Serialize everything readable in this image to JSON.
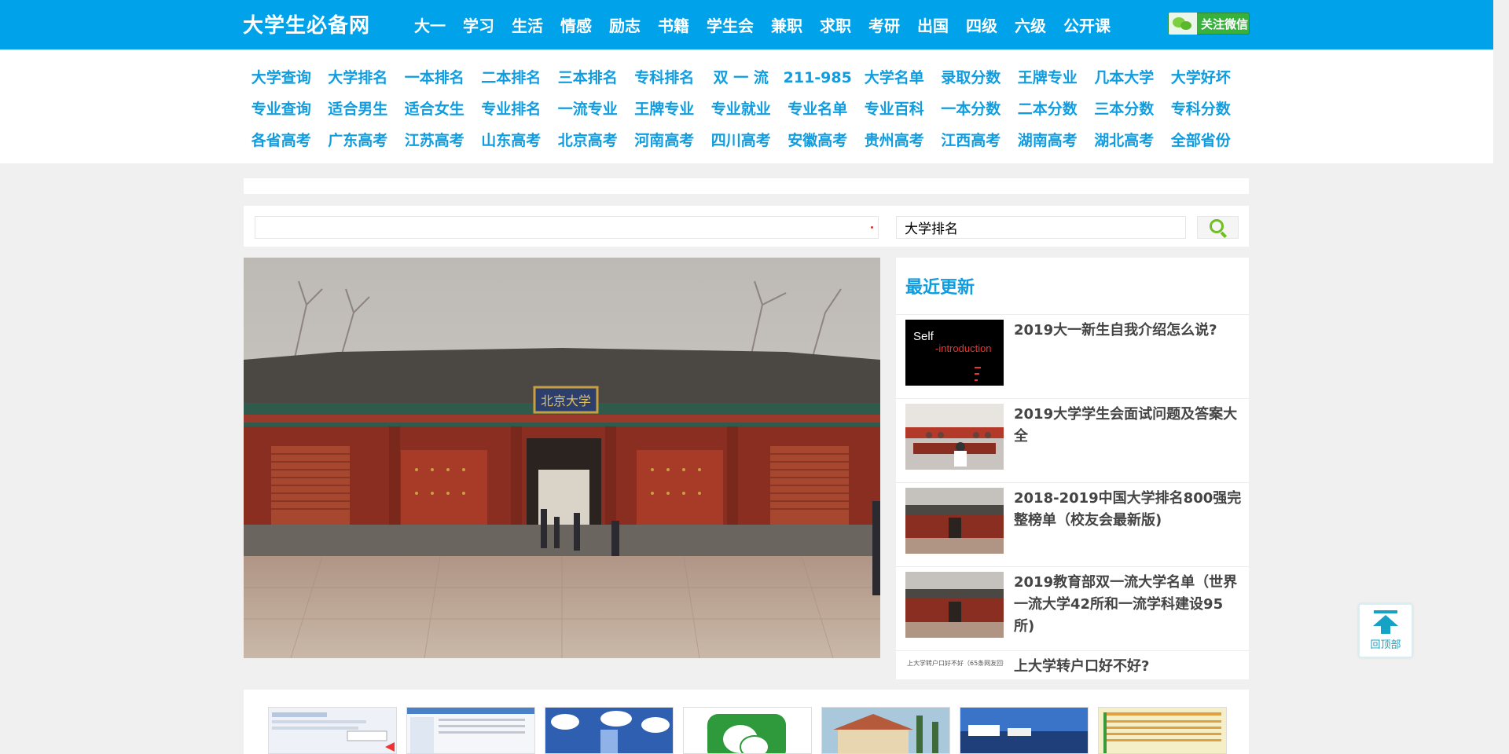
{
  "header": {
    "logo": "大学生必备网",
    "nav": [
      "大一",
      "学习",
      "生活",
      "情感",
      "励志",
      "书籍",
      "学生会",
      "兼职",
      "求职",
      "考研",
      "出国",
      "四级",
      "六级",
      "公开课"
    ],
    "wechat_label": "关注微信"
  },
  "quick_links": [
    "大学查询",
    "大学排名",
    "一本排名",
    "二本排名",
    "三本排名",
    "专科排名",
    "双 一 流",
    "211-985",
    "大学名单",
    "录取分数",
    "王牌专业",
    "几本大学",
    "大学好坏",
    "专业查询",
    "适合男生",
    "适合女生",
    "专业排名",
    "一流专业",
    "王牌专业",
    "专业就业",
    "专业名单",
    "专业百科",
    "一本分数",
    "二本分数",
    "三本分数",
    "专科分数",
    "各省高考",
    "广东高考",
    "江苏高考",
    "山东高考",
    "北京高考",
    "河南高考",
    "四川高考",
    "安徽高考",
    "贵州高考",
    "江西高考",
    "湖南高考",
    "湖北高考",
    "全部省份"
  ],
  "search": {
    "value": "大学排名"
  },
  "recent": {
    "title": "最近更新",
    "items": [
      {
        "title": "2019大一新生自我介绍怎么说?",
        "thumb": "self-introduction",
        "thumb_text_1": "Self",
        "thumb_text_2": "-introduction"
      },
      {
        "title": "2019大学学生会面试问题及答案大全",
        "thumb": "meeting"
      },
      {
        "title": "2018-2019中国大学排名800强完整榜单（校友会最新版)",
        "thumb": "gate"
      },
      {
        "title": "2019教育部双一流大学名单（世界一流大学42所和一流学科建设95所)",
        "thumb": "gate"
      },
      {
        "title": "上大学转户口好不好?",
        "thumb": "doc",
        "thumb_text": "上大学转户口好不好（65条网友回答）"
      }
    ]
  },
  "backtop": {
    "label": "回顶部"
  },
  "hero": {
    "sign": "北京大学"
  }
}
